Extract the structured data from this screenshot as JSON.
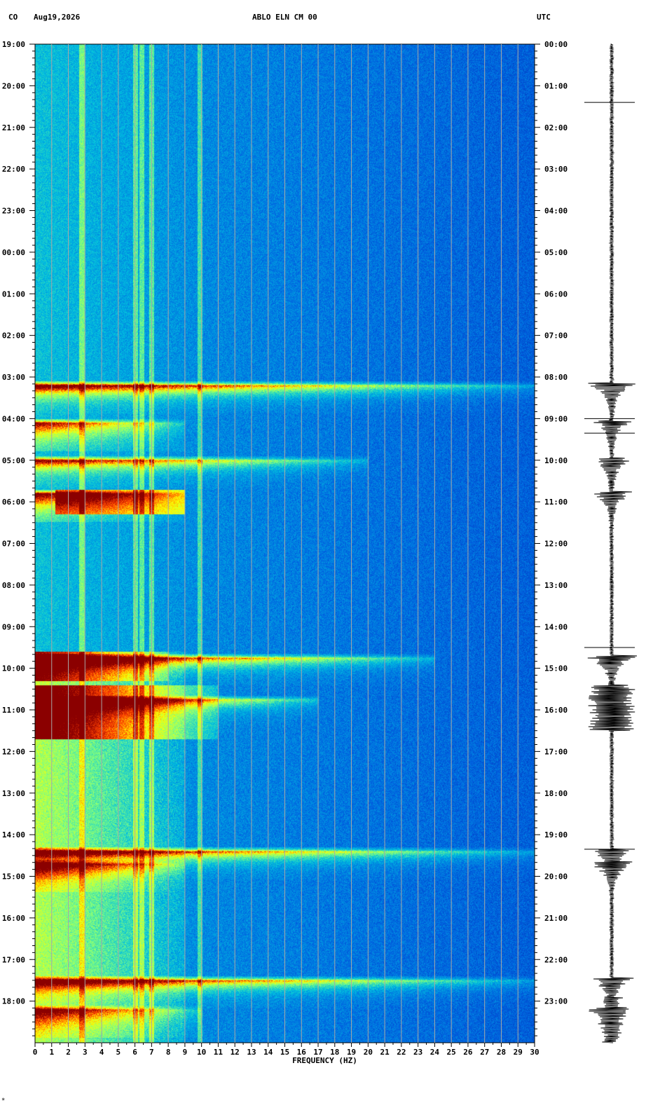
{
  "header": {
    "network": "CO",
    "date": "Aug19,2026",
    "station": "ABLO ELN CM 00",
    "timezone": "UTC"
  },
  "corner_mark": "*",
  "chart_data": {
    "type": "heatmap",
    "title": "ABLO ELN CM 00",
    "xlabel": "FREQUENCY (HZ)",
    "xlim": [
      0,
      30
    ],
    "x_ticks": [
      "0",
      "1",
      "2",
      "3",
      "4",
      "5",
      "6",
      "7",
      "8",
      "9",
      "10",
      "11",
      "12",
      "13",
      "14",
      "15",
      "16",
      "17",
      "18",
      "19",
      "20",
      "21",
      "22",
      "23",
      "24",
      "25",
      "26",
      "27",
      "28",
      "29",
      "30"
    ],
    "y_ticks_left": [
      "19:00",
      "20:00",
      "21:00",
      "22:00",
      "23:00",
      "00:00",
      "01:00",
      "02:00",
      "03:00",
      "04:00",
      "05:00",
      "06:00",
      "07:00",
      "08:00",
      "09:00",
      "10:00",
      "11:00",
      "12:00",
      "13:00",
      "14:00",
      "15:00",
      "16:00",
      "17:00",
      "18:00"
    ],
    "y_ticks_right": [
      "00:00",
      "01:00",
      "02:00",
      "03:00",
      "04:00",
      "05:00",
      "06:00",
      "07:00",
      "08:00",
      "09:00",
      "10:00",
      "11:00",
      "12:00",
      "13:00",
      "14:00",
      "15:00",
      "16:00",
      "17:00",
      "18:00",
      "19:00",
      "20:00",
      "21:00",
      "22:00",
      "23:00"
    ],
    "ylim_hours": [
      0,
      24
    ],
    "grid": true,
    "colormap": [
      "#0020a0",
      "#0060e0",
      "#00c0e0",
      "#80ff80",
      "#ffff00",
      "#ff4000",
      "#8b0000"
    ],
    "line_bands_hz": [
      2.8,
      6.0,
      6.4,
      7.0,
      9.9
    ],
    "events": [
      {
        "utc_hour": 8.2,
        "fmax_hz": 30,
        "strength": 0.95
      },
      {
        "utc_hour": 9.1,
        "fmax_hz": 9,
        "strength": 0.75
      },
      {
        "utc_hour": 10.0,
        "fmax_hz": 20,
        "strength": 0.8
      },
      {
        "utc_hour": 10.8,
        "fmax_hz": 9,
        "strength": 0.85
      },
      {
        "utc_hour": 14.75,
        "fmax_hz": 24,
        "strength": 1.0
      },
      {
        "utc_hour": 15.75,
        "fmax_hz": 17,
        "strength": 1.0
      },
      {
        "utc_hour": 19.4,
        "fmax_hz": 30,
        "strength": 0.9
      },
      {
        "utc_hour": 19.7,
        "fmax_hz": 9,
        "strength": 0.7
      },
      {
        "utc_hour": 22.5,
        "fmax_hz": 30,
        "strength": 0.9
      },
      {
        "utc_hour": 23.2,
        "fmax_hz": 10,
        "strength": 0.7
      }
    ]
  }
}
